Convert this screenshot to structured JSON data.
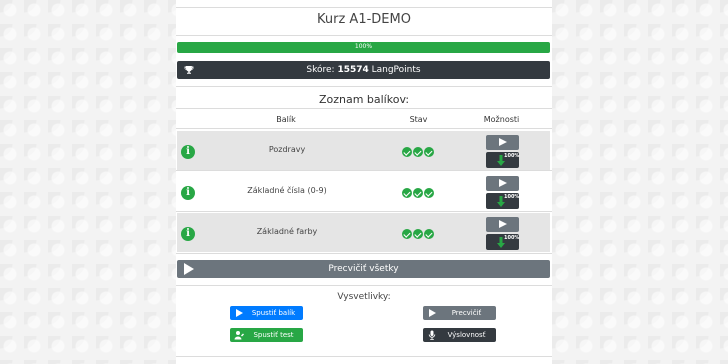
{
  "course": {
    "title": "Kurz A1-DEMO"
  },
  "progress": {
    "value": 100,
    "label": "100%"
  },
  "score": {
    "prefix": "Skóre: ",
    "value": "15574",
    "suffix": " LangPoints"
  },
  "packages": {
    "heading": "Zoznam balíkov:",
    "columns": {
      "package": "Balík",
      "status": "Stav",
      "options": "Možnosti"
    },
    "rows": [
      {
        "name": "Pozdravy",
        "info": "i",
        "status_checks": 3,
        "download_pct": "100%"
      },
      {
        "name": "Základné čísla (0-9)",
        "info": "i",
        "status_checks": 3,
        "download_pct": "100%"
      },
      {
        "name": "Základné farby",
        "info": "i",
        "status_checks": 3,
        "download_pct": "100%"
      }
    ],
    "practice_all_label": "Precvičiť všetky"
  },
  "legend": {
    "title": "Vysvetlivky:",
    "items": {
      "start_package": "Spustiť balík",
      "practice": "Precvičiť",
      "start_test": "Spustiť test",
      "pronunciation": "Výslovnosť"
    }
  },
  "colors": {
    "green": "#28a745",
    "dark": "#343a40",
    "gray": "#6c757d",
    "blue": "#007bff"
  },
  "icons": {
    "score": "trophy-icon",
    "row_info": "info-icon",
    "status": "check-circle-icon",
    "play": "play-icon",
    "download": "download-arrow-icon",
    "start_test": "user-edit-icon",
    "pronunciation": "microphone-icon"
  }
}
